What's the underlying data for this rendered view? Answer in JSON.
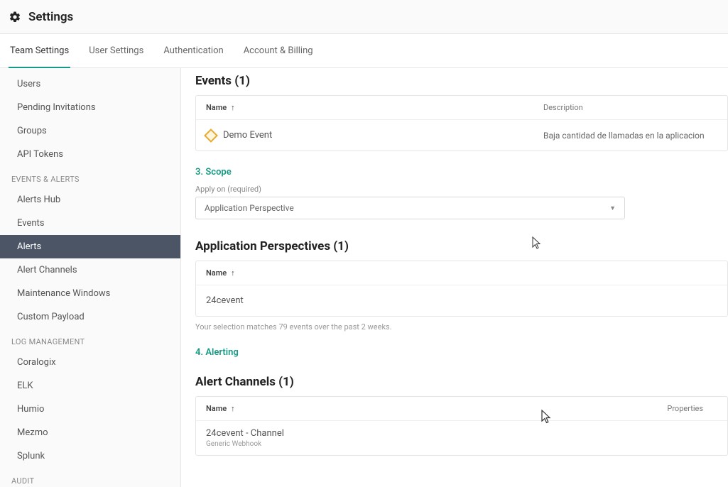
{
  "header": {
    "title": "Settings"
  },
  "tabs": [
    {
      "label": "Team Settings",
      "active": true
    },
    {
      "label": "User Settings",
      "active": false
    },
    {
      "label": "Authentication",
      "active": false
    },
    {
      "label": "Account & Billing",
      "active": false
    }
  ],
  "sidebar": {
    "groups": [
      {
        "title": "",
        "items": [
          {
            "label": "Users",
            "active": false
          },
          {
            "label": "Pending Invitations",
            "active": false
          },
          {
            "label": "Groups",
            "active": false
          },
          {
            "label": "API Tokens",
            "active": false
          }
        ]
      },
      {
        "title": "EVENTS & ALERTS",
        "items": [
          {
            "label": "Alerts Hub",
            "active": false
          },
          {
            "label": "Events",
            "active": false
          },
          {
            "label": "Alerts",
            "active": true
          },
          {
            "label": "Alert Channels",
            "active": false
          },
          {
            "label": "Maintenance Windows",
            "active": false
          },
          {
            "label": "Custom Payload",
            "active": false
          }
        ]
      },
      {
        "title": "LOG MANAGEMENT",
        "items": [
          {
            "label": "Coralogix",
            "active": false
          },
          {
            "label": "ELK",
            "active": false
          },
          {
            "label": "Humio",
            "active": false
          },
          {
            "label": "Mezmo",
            "active": false
          },
          {
            "label": "Splunk",
            "active": false
          }
        ]
      },
      {
        "title": "AUDIT",
        "items": []
      }
    ]
  },
  "main": {
    "events": {
      "heading": "Events (1)",
      "columns": {
        "name": "Name",
        "description": "Description"
      },
      "rows": [
        {
          "name": "Demo Event",
          "description": "Baja cantidad de llamadas en la aplicacion"
        }
      ]
    },
    "scope": {
      "step": "3. Scope",
      "apply_on_label": "Apply on (required)",
      "apply_on_value": "Application Perspective"
    },
    "perspectives": {
      "heading": "Application Perspectives (1)",
      "columns": {
        "name": "Name"
      },
      "rows": [
        {
          "name": "24cevent"
        }
      ],
      "hint": "Your selection matches 79 events over the past 2 weeks."
    },
    "alerting": {
      "step": "4. Alerting"
    },
    "alert_channels": {
      "heading": "Alert Channels (1)",
      "columns": {
        "name": "Name",
        "properties": "Properties"
      },
      "rows": [
        {
          "name": "24cevent - Channel",
          "subtype": "Generic Webhook"
        }
      ]
    }
  }
}
